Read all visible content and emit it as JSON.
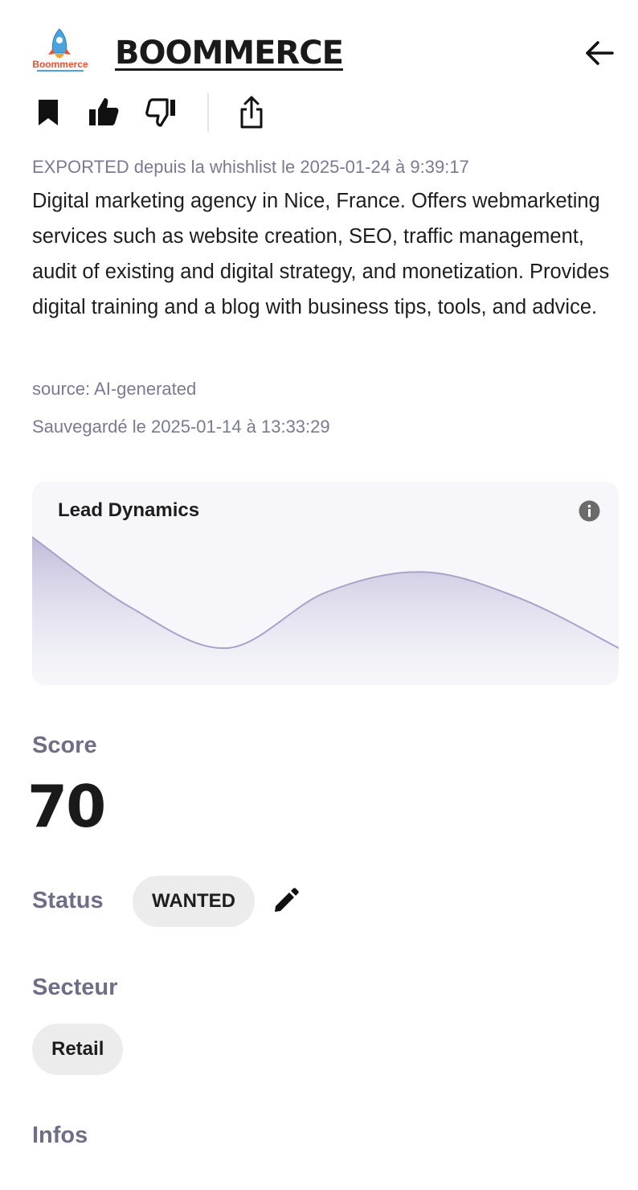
{
  "header": {
    "logo_text": "Boommerce",
    "company_name": "BOOMMERCE",
    "back_icon": "arrow-left-icon"
  },
  "actions": {
    "icons": [
      "bookmark-icon",
      "thumbs-up-icon",
      "thumbs-down-icon",
      "share-icon"
    ]
  },
  "meta": {
    "exported": "EXPORTED depuis la whishlist le 2025-01-24 à 9:39:17",
    "source": "source: AI-generated",
    "saved": "Sauvegardé le 2025-01-14 à 13:33:29"
  },
  "description": "Digital marketing agency in Nice, France. Offers webmarketing services such as website creation, SEO, traffic management, audit of existing and digital strategy, and monetization. Provides digital training and a blog with business tips, tools, and advice.",
  "lead_dynamics": {
    "title": "Lead Dynamics",
    "info_icon": "info-icon"
  },
  "chart_data": {
    "type": "area",
    "title": "Lead Dynamics",
    "x": [
      0,
      1,
      2,
      3,
      4,
      5,
      6
    ],
    "values": [
      0.72,
      0.38,
      0.18,
      0.45,
      0.55,
      0.42,
      0.18
    ],
    "ylim": [
      0,
      1
    ],
    "grid": false,
    "color": "#a8a3c8"
  },
  "score": {
    "label": "Score",
    "value": "70"
  },
  "status": {
    "label": "Status",
    "value": "WANTED",
    "edit_icon": "pencil-icon"
  },
  "sector": {
    "label": "Secteur",
    "value": "Retail"
  },
  "infos": {
    "label": "Infos"
  },
  "colors": {
    "muted_text": "#7a7a90",
    "label_text": "#6e6e86",
    "pill_bg": "#ececec",
    "card_bg": "#f7f7fb",
    "chart_line": "#a8a3c8"
  }
}
